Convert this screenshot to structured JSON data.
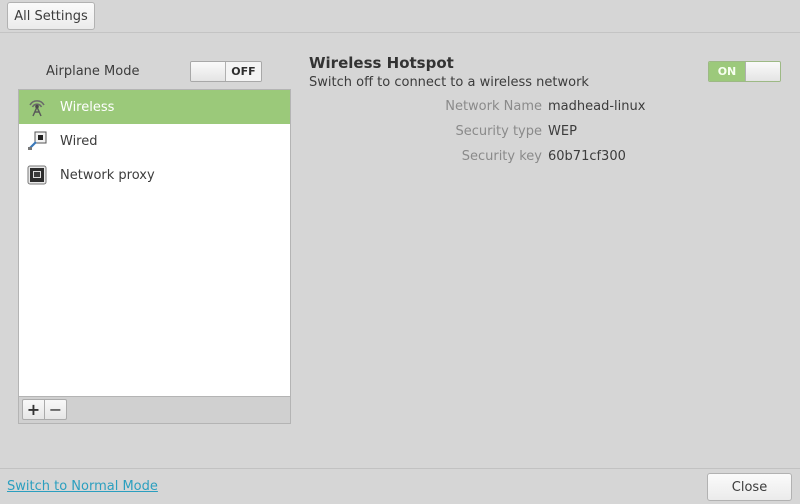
{
  "toolbar": {
    "all_settings_label": "All Settings"
  },
  "airplane": {
    "label": "Airplane Mode",
    "state": "OFF"
  },
  "connections": {
    "items": [
      {
        "label": "Wireless",
        "icon": "wireless-icon",
        "selected": true
      },
      {
        "label": "Wired",
        "icon": "wired-icon",
        "selected": false
      },
      {
        "label": "Network proxy",
        "icon": "network-proxy-icon",
        "selected": false
      }
    ],
    "add_label": "+",
    "remove_label": "−"
  },
  "hotspot": {
    "title": "Wireless Hotspot",
    "subtitle": "Switch off to connect to a wireless network",
    "state": "ON",
    "details": [
      {
        "label": "Network Name",
        "value": "madhead-linux"
      },
      {
        "label": "Security type",
        "value": "WEP"
      },
      {
        "label": "Security key",
        "value": "60b71cf300"
      }
    ]
  },
  "footer": {
    "normal_mode_link": "Switch to Normal Mode",
    "close_label": "Close"
  },
  "colors": {
    "accent": "#9bc97a",
    "link": "#2b9fbf",
    "background": "#d6d6d6"
  }
}
